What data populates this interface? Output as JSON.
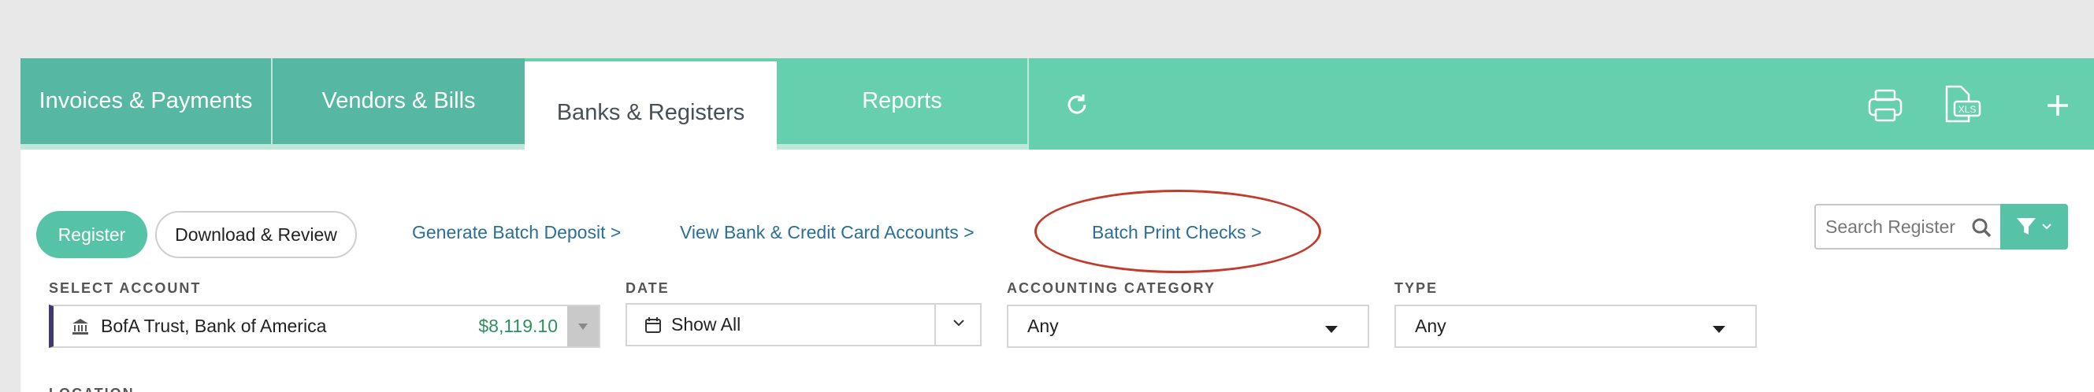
{
  "tabs": {
    "items": [
      {
        "label": "Invoices & Payments"
      },
      {
        "label": "Vendors & Bills"
      },
      {
        "label": "Banks & Registers"
      },
      {
        "label": "Reports"
      }
    ],
    "active": "Banks & Registers"
  },
  "toolbar_icons": [
    "refresh-icon",
    "print-icon",
    "xls-export-icon",
    "add-icon"
  ],
  "actions": {
    "register": "Register",
    "download_review": "Download & Review",
    "generate_batch_deposit": "Generate Batch Deposit >",
    "view_accounts": "View Bank & Credit Card Accounts >",
    "batch_print_checks": "Batch Print Checks >"
  },
  "search": {
    "placeholder": "Search Register"
  },
  "filters": {
    "account": {
      "label": "SELECT ACCOUNT",
      "name": "BofA Trust, Bank of America",
      "balance": "$8,119.10"
    },
    "date": {
      "label": "DATE",
      "value": "Show All"
    },
    "category": {
      "label": "ACCOUNTING CATEGORY",
      "value": "Any"
    },
    "type": {
      "label": "TYPE",
      "value": "Any"
    },
    "location": {
      "label": "LOCATION"
    }
  },
  "colors": {
    "tab_bg": "#66cfad",
    "tab_inactive": "#56b8a2",
    "link": "#2a6f96",
    "highlight": "#c23b2c",
    "balance": "#2f8f5e"
  }
}
